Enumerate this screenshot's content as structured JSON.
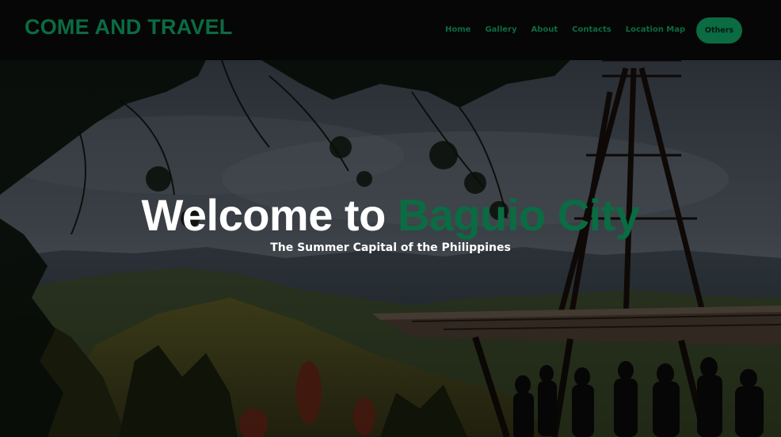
{
  "brand": {
    "title": "COME AND TRAVEL"
  },
  "nav": {
    "links": [
      {
        "label": "Home"
      },
      {
        "label": "Gallery"
      },
      {
        "label": "About"
      },
      {
        "label": "Contacts"
      },
      {
        "label": "Location Map"
      }
    ],
    "others_label": "Others"
  },
  "hero": {
    "title_prefix": "Welcome to ",
    "title_accent": "Baguio City",
    "subtitle": "The Summer Capital of the Philippines"
  },
  "colors": {
    "accent": "#0b6b43",
    "header_background": "#060606",
    "hero_text": "#ffffff"
  }
}
